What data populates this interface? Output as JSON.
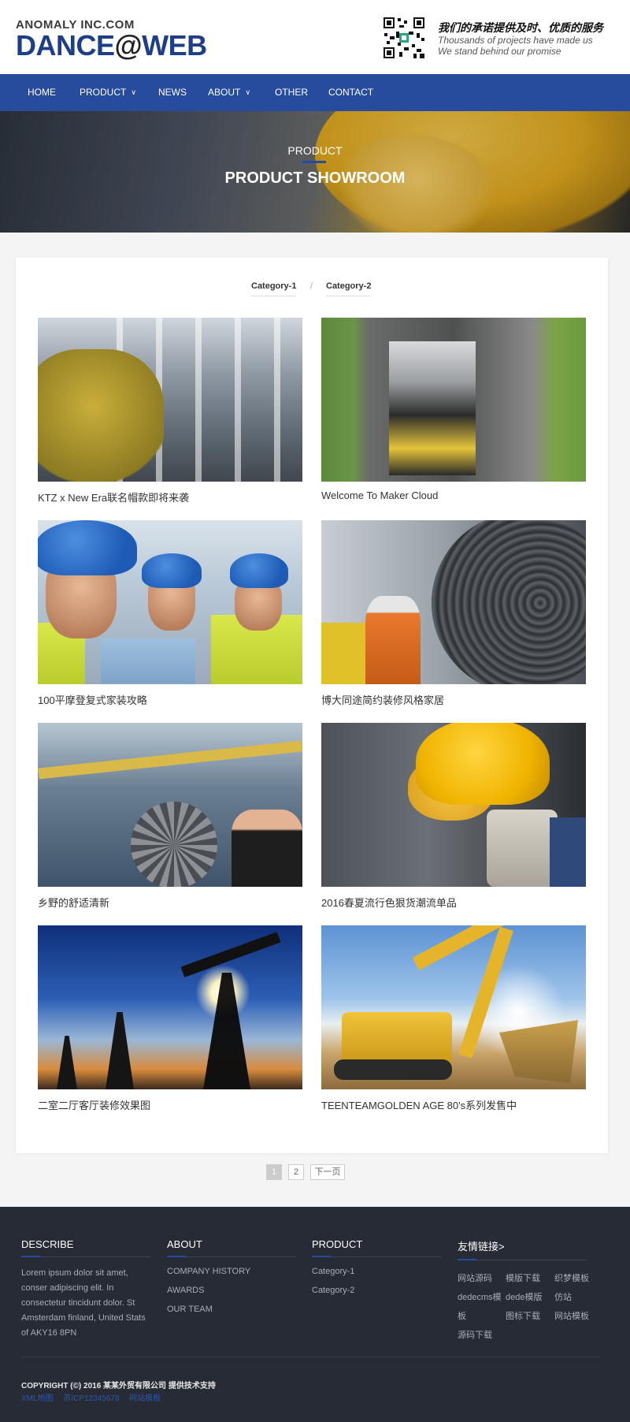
{
  "header": {
    "logo_small": "ANOMALY INC.COM",
    "logo_big_1": "DANCE",
    "logo_big_at": "@",
    "logo_big_2": "WEB",
    "promise_cn": "我们的承诺提供及时、优质的服务",
    "promise_en_1": "Thousands of projects have made us",
    "promise_en_2": "We stand behind our promise"
  },
  "nav": {
    "items": [
      {
        "label": "HOME"
      },
      {
        "label": "PRODUCT"
      },
      {
        "label": "NEWS"
      },
      {
        "label": "ABOUT"
      },
      {
        "label": "OTHER"
      },
      {
        "label": "CONTACT"
      }
    ]
  },
  "banner": {
    "subtitle": "PRODUCT",
    "title": "PRODUCT SHOWROOM"
  },
  "categories": {
    "items": [
      "Category-1",
      "Category-2"
    ],
    "separator": "/"
  },
  "products": [
    {
      "caption": "KTZ x New Era联名帽款即将来袭",
      "image": "factory-workers-photo"
    },
    {
      "caption": "Welcome To Maker Cloud",
      "image": "road-paver-photo"
    },
    {
      "caption": "100平摩登复式家装攻略",
      "image": "engineers-hardhats-photo"
    },
    {
      "caption": "博大同途简约装修风格家居",
      "image": "turbine-worker-photo"
    },
    {
      "caption": "乡野的舒适清新",
      "image": "gear-mechanic-photo"
    },
    {
      "caption": "2016春夏流行色狠货潮流单品",
      "image": "yellow-hardhat-photo"
    },
    {
      "caption": "二室二厅客厅装修效果图",
      "image": "oil-pumps-photo"
    },
    {
      "caption": "TEENTEAMGOLDEN AGE 80's系列发售中",
      "image": "excavator-photo"
    }
  ],
  "pagination": {
    "pages": [
      "1",
      "2"
    ],
    "current": "1",
    "next": "下一页"
  },
  "footer": {
    "describe": {
      "title": "DESCRIBE",
      "text": "Lorem ipsum dolor sit amet, conser adipiscing elit. In consectetur tincidunt dolor. St Amsterdam finland, United Stats of AKY16 8PN"
    },
    "about": {
      "title": "ABOUT",
      "links": [
        "COMPANY HISTORY",
        "AWARDS",
        "OUR TEAM"
      ]
    },
    "product": {
      "title": "PRODUCT",
      "links": [
        "Category-1",
        "Category-2"
      ]
    },
    "friends": {
      "title": "友情链接>",
      "links": [
        "网站源码",
        "模版下载",
        "织梦模板",
        "dedecms模",
        "dede模版",
        "仿站",
        "板",
        "图标下载",
        "网站模板",
        "源码下载"
      ]
    },
    "copyright": "COPYRIGHT (©) 2016 某某外贸有限公司 提供技术支持",
    "bottom_links": [
      "XML地图",
      "苏ICP12345678",
      "网站模板"
    ]
  },
  "colors": {
    "brand_blue": "#274c9d",
    "footer_bg": "#262b35"
  }
}
